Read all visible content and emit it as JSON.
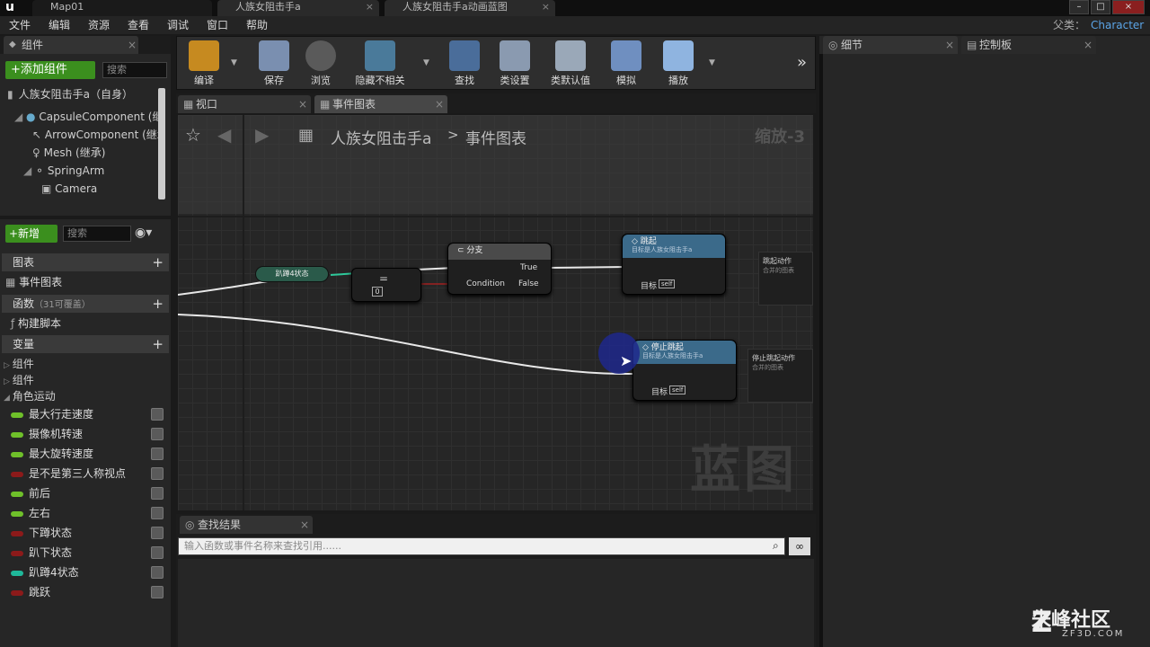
{
  "titlebar": {
    "logo": "u",
    "tabs": [
      "Map01",
      "人族女阻击手a",
      "人族女阻击手a动画蓝图"
    ],
    "parent_label": "父类：",
    "parent_value": "Character"
  },
  "menubar": [
    "文件",
    "编辑",
    "资源",
    "查看",
    "调试",
    "窗口",
    "帮助"
  ],
  "components_panel": {
    "tab": "组件",
    "add_button": "+添加组件",
    "search_placeholder": "搜索",
    "root": "人族女阻击手a（自身）",
    "items": [
      "CapsuleComponent (继承)",
      "ArrowComponent (继承)",
      "Mesh (继承)",
      "SpringArm",
      "Camera"
    ]
  },
  "mybp_panel": {
    "new_button": "+新增",
    "search_placeholder": "搜索",
    "sections": {
      "graph": "图表",
      "event_graph": "事件图表",
      "functions": "函数",
      "functions_count": "（31可覆盖）",
      "construct": "构建脚本",
      "variables": "变量"
    },
    "categories": [
      "组件",
      "组件",
      "角色运动"
    ],
    "variables": [
      {
        "name": "最大行走速度",
        "color": "#6fc02a"
      },
      {
        "name": "摄像机转速",
        "color": "#6fc02a"
      },
      {
        "name": "最大旋转速度",
        "color": "#6fc02a"
      },
      {
        "name": "是不是第三人称视点",
        "color": "#8c1a1a"
      },
      {
        "name": "前后",
        "color": "#6fc02a"
      },
      {
        "name": "左右",
        "color": "#6fc02a"
      },
      {
        "name": "下蹲状态",
        "color": "#8c1a1a"
      },
      {
        "name": "趴下状态",
        "color": "#8c1a1a"
      },
      {
        "name": "趴蹲4状态",
        "color": "#1fb89a"
      },
      {
        "name": "跳跃",
        "color": "#8c1a1a"
      }
    ]
  },
  "toolbar": {
    "buttons": [
      "编译",
      "保存",
      "浏览",
      "隐藏不相关",
      "查找",
      "类设置",
      "类默认值",
      "模拟",
      "播放"
    ]
  },
  "editor_tabs": [
    "视口",
    "事件图表"
  ],
  "graph": {
    "breadcrumb_bp": "人族女阻击手a",
    "breadcrumb_sep": ">",
    "breadcrumb_graph": "事件图表",
    "zoom": "缩放-3",
    "watermark": "蓝图",
    "var_node": "趴蹲4状态",
    "compare_value": "0",
    "branch": {
      "title": "分支",
      "true": "True",
      "condition": "Condition",
      "false": "False"
    },
    "jump": {
      "title": "跳起",
      "subtitle": "目标是人族女阻击手a",
      "target": "目标",
      "self": "self"
    },
    "stop_jump": {
      "title": "停止跳起",
      "subtitle": "目标是人族女阻击手a",
      "target": "目标",
      "self": "self"
    },
    "collapsed1": {
      "title": "跳起动作",
      "sub": "合并的图表"
    },
    "collapsed2": {
      "title": "停止跳起动作",
      "sub": "合并的图表"
    }
  },
  "find_results": {
    "tab": "查找结果",
    "placeholder": "输入函数或事件名称来查找引用......"
  },
  "right_panels": {
    "details": "细节",
    "palette": "控制板"
  },
  "corner_watermark": {
    "brand": "朱峰社区",
    "url": "ZF3D.COM"
  }
}
